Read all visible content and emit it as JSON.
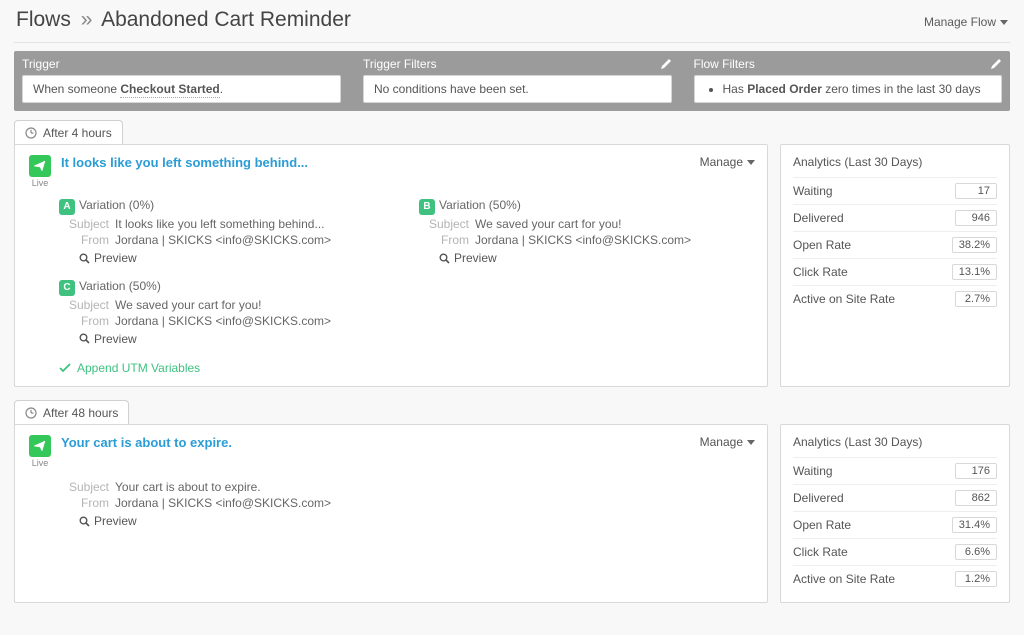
{
  "header": {
    "crumb_root": "Flows",
    "crumb_sep": "»",
    "title": "Abandoned Cart Reminder",
    "manage_flow": "Manage Flow"
  },
  "trigger": {
    "label": "Trigger",
    "prefix": "When someone ",
    "event": "Checkout Started",
    "suffix": "."
  },
  "trigger_filters": {
    "label": "Trigger Filters",
    "text": "No conditions have been set."
  },
  "flow_filters": {
    "label": "Flow Filters",
    "prefix": "Has ",
    "event": "Placed Order",
    "suffix": " zero times in the last 30 days"
  },
  "steps": [
    {
      "delay": "After 4 hours",
      "live": "Live",
      "title": "It looks like you left something behind...",
      "manage": "Manage",
      "variations": [
        {
          "badge": "A",
          "header": "Variation (0%)",
          "subject": "It looks like you left something behind...",
          "from": "Jordana | SKICKS <info@SKICKS.com>",
          "preview": "Preview"
        },
        {
          "badge": "B",
          "header": "Variation (50%)",
          "subject": "We saved your cart for you!",
          "from": "Jordana | SKICKS <info@SKICKS.com>",
          "preview": "Preview"
        },
        {
          "badge": "C",
          "header": "Variation (50%)",
          "subject": "We saved your cart for you!",
          "from": "Jordana | SKICKS <info@SKICKS.com>",
          "preview": "Preview"
        }
      ],
      "utm": "Append UTM Variables",
      "analytics": {
        "title": "Analytics (Last 30 Days)",
        "rows": [
          {
            "label": "Waiting",
            "value": "17"
          },
          {
            "label": "Delivered",
            "value": "946"
          },
          {
            "label": "Open Rate",
            "value": "38.2%"
          },
          {
            "label": "Click Rate",
            "value": "13.1%"
          },
          {
            "label": "Active on Site Rate",
            "value": "2.7%"
          }
        ]
      }
    },
    {
      "delay": "After 48 hours",
      "live": "Live",
      "title": "Your cart is about to expire.",
      "manage": "Manage",
      "variations": [
        {
          "badge": "",
          "header": "",
          "subject": "Your cart is about to expire.",
          "from": "Jordana | SKICKS <info@SKICKS.com>",
          "preview": "Preview"
        }
      ],
      "utm": "",
      "analytics": {
        "title": "Analytics (Last 30 Days)",
        "rows": [
          {
            "label": "Waiting",
            "value": "176"
          },
          {
            "label": "Delivered",
            "value": "862"
          },
          {
            "label": "Open Rate",
            "value": "31.4%"
          },
          {
            "label": "Click Rate",
            "value": "6.6%"
          },
          {
            "label": "Active on Site Rate",
            "value": "1.2%"
          }
        ]
      }
    }
  ],
  "labels": {
    "subject": "Subject",
    "from": "From"
  }
}
